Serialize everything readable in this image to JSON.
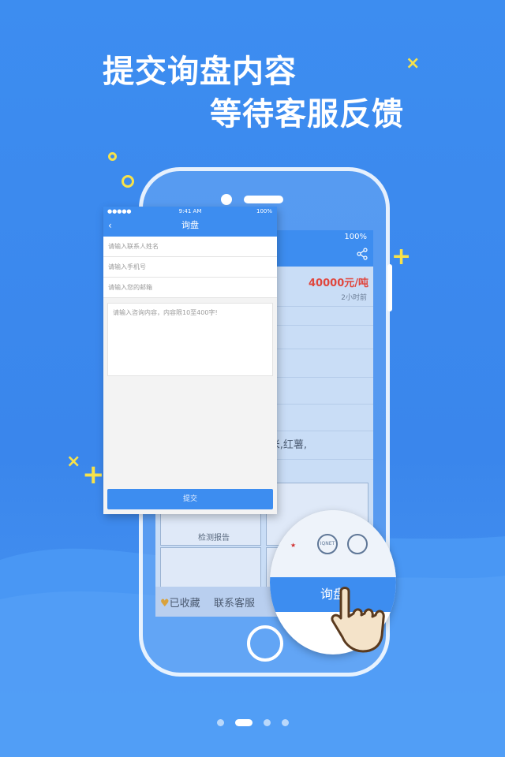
{
  "headline": {
    "line1": "提交询盘内容",
    "line2": "等待客服反馈"
  },
  "colors": {
    "primary": "#3d8df0",
    "accent": "#f7e24a",
    "price": "#e0463d"
  },
  "background_app": {
    "status_battery": "100%",
    "price": "40000元/吨",
    "time_ago": "2小时前",
    "product_fragment": "米,红薯,",
    "certificate_label": "检测报告",
    "favorite_label": "已收藏",
    "contact_label": "联系客服"
  },
  "form_screen": {
    "status": {
      "signal": "●●●●● ",
      "time": "9:41 AM",
      "battery": "100%"
    },
    "title": "询盘",
    "name_placeholder": "请输入联系人姓名",
    "phone_placeholder": "请输入手机号",
    "email_placeholder": "请输入您的邮箱",
    "content_placeholder": "请输入咨询内容，内容限10至400字!",
    "submit_label": "提交"
  },
  "magnifier": {
    "inquiry_label": "询盘",
    "logo_text": "IQNET"
  },
  "pager": {
    "total": 4,
    "active_index": 1
  },
  "icons": [
    "back-arrow-icon",
    "share-icon",
    "heart-icon",
    "hand-pointer-icon",
    "wifi-icon",
    "battery-icon"
  ]
}
